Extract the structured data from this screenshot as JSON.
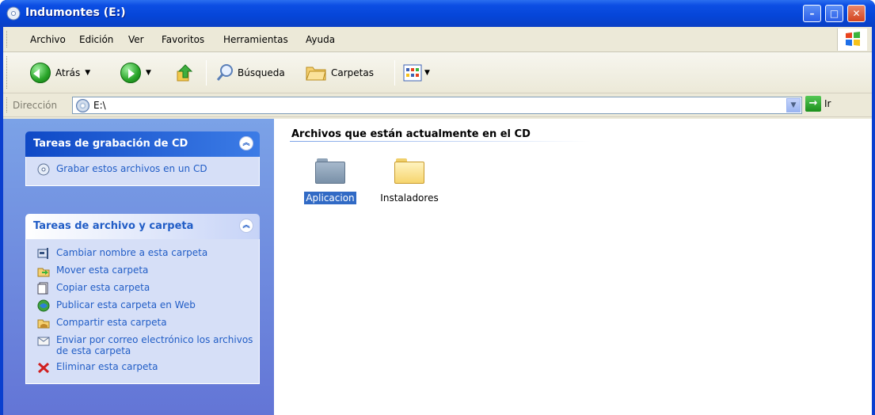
{
  "window": {
    "title": "Indumontes (E:)",
    "controls": {
      "minimize": "–",
      "maximize": "□",
      "close": "✕"
    }
  },
  "menubar": {
    "items": [
      "Archivo",
      "Edición",
      "Ver",
      "Favoritos",
      "Herramientas",
      "Ayuda"
    ]
  },
  "toolbar": {
    "back_label": "Atrás",
    "search_label": "Búsqueda",
    "folders_label": "Carpetas"
  },
  "address": {
    "label": "Dirección",
    "value": "E:\\",
    "go_label": "Ir"
  },
  "tasks": {
    "cd_panel": {
      "title": "Tareas de grabación de CD",
      "items": [
        "Grabar estos archivos en un CD"
      ]
    },
    "file_panel": {
      "title": "Tareas de archivo y carpeta",
      "items": [
        "Cambiar nombre a esta carpeta",
        "Mover esta carpeta",
        "Copiar esta carpeta",
        "Publicar esta carpeta en Web",
        "Compartir esta carpeta",
        "Enviar por correo electrónico los archivos de esta carpeta",
        "Eliminar esta carpeta"
      ],
      "icons": [
        "rename-icon",
        "move-icon",
        "copy-icon",
        "publish-web-icon",
        "share-icon",
        "email-icon",
        "delete-icon"
      ]
    }
  },
  "main": {
    "group_title": "Archivos que están actualmente en el CD",
    "items": [
      {
        "name": "Aplicacion",
        "selected": true
      },
      {
        "name": "Instaladores",
        "selected": false
      }
    ]
  },
  "colors": {
    "titlebar": "#0a3fcf",
    "task_pane": "#6375d6",
    "selection": "#316ac5",
    "link": "#215dc6"
  }
}
